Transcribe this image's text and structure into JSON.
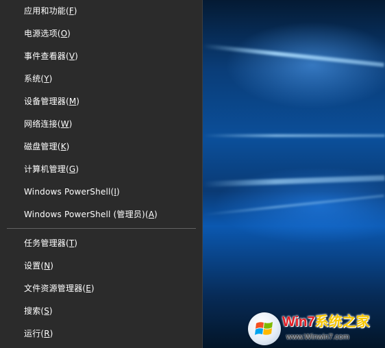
{
  "menu": {
    "items": [
      {
        "label": "应用和功能(",
        "accel": "F",
        "suffix": ")"
      },
      {
        "label": "电源选项(",
        "accel": "O",
        "suffix": ")"
      },
      {
        "label": "事件查看器(",
        "accel": "V",
        "suffix": ")"
      },
      {
        "label": "系统(",
        "accel": "Y",
        "suffix": ")"
      },
      {
        "label": "设备管理器(",
        "accel": "M",
        "suffix": ")"
      },
      {
        "label": "网络连接(",
        "accel": "W",
        "suffix": ")"
      },
      {
        "label": "磁盘管理(",
        "accel": "K",
        "suffix": ")"
      },
      {
        "label": "计算机管理(",
        "accel": "G",
        "suffix": ")"
      },
      {
        "label": "Windows PowerShell(",
        "accel": "I",
        "suffix": ")"
      },
      {
        "label": "Windows PowerShell (管理员)(",
        "accel": "A",
        "suffix": ")"
      },
      {
        "label": "任务管理器(",
        "accel": "T",
        "suffix": ")"
      },
      {
        "label": "设置(",
        "accel": "N",
        "suffix": ")"
      },
      {
        "label": "文件资源管理器(",
        "accel": "E",
        "suffix": ")"
      },
      {
        "label": "搜索(",
        "accel": "S",
        "suffix": ")"
      },
      {
        "label": "运行(",
        "accel": "R",
        "suffix": ")"
      }
    ]
  },
  "watermark": {
    "title_prefix": "Win7",
    "title_suffix": "系统之家",
    "url": "www.Winwin7.com",
    "logo_icon": "windows-logo-icon"
  },
  "colors": {
    "menu_background": "#2b2b2b",
    "menu_text": "#ffffff",
    "separator": "#636363",
    "wallpaper_blue": "#0b4f9a"
  }
}
